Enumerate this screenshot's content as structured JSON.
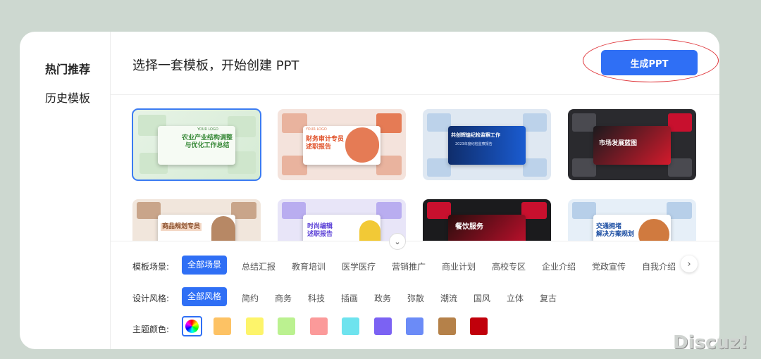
{
  "sidebar": {
    "items": [
      {
        "label": "热门推荐"
      },
      {
        "label": "历史模板"
      }
    ]
  },
  "header": {
    "title": "选择一套模板，开始创建 PPT",
    "generate_label": "生成PPT"
  },
  "templates": [
    {
      "caption": "农业产业结构调整\n与优化工作总结",
      "logo": "YOUR LOGO",
      "theme": "green"
    },
    {
      "caption": "财务审计专员\n述职报告",
      "logo": "YOUR LOGO",
      "theme": "orange"
    },
    {
      "caption": "共创辉煌纪检监察工作",
      "sub": "2023年度纪检监察报告",
      "theme": "blue"
    },
    {
      "caption": "市场发展蓝图",
      "theme": "red-dark"
    },
    {
      "caption": "商品规划专员",
      "theme": "brown"
    },
    {
      "caption": "时尚编辑\n述职报告",
      "theme": "purple"
    },
    {
      "caption": "餐饮服务",
      "theme": "red-black"
    },
    {
      "caption": "交通拥堵\n解决方案规划",
      "theme": "lightblue"
    }
  ],
  "filters": {
    "scene_label": "模板场景:",
    "scenes": [
      "全部场景",
      "总结汇报",
      "教育培训",
      "医学医疗",
      "营销推广",
      "商业计划",
      "高校专区",
      "企业介绍",
      "党政宣传",
      "自我介绍"
    ],
    "style_label": "设计风格:",
    "styles": [
      "全部风格",
      "简约",
      "商务",
      "科技",
      "插画",
      "政务",
      "弥散",
      "潮流",
      "国风",
      "立体",
      "复古"
    ],
    "color_label": "主题颜色:",
    "colors": [
      "#fdc264",
      "#fdf46a",
      "#bbf190",
      "#fb9a9a",
      "#6ee3ee",
      "#7b62f3",
      "#6b8bf7",
      "#b58149",
      "#c1000b"
    ]
  },
  "watermark": "Discuz!"
}
